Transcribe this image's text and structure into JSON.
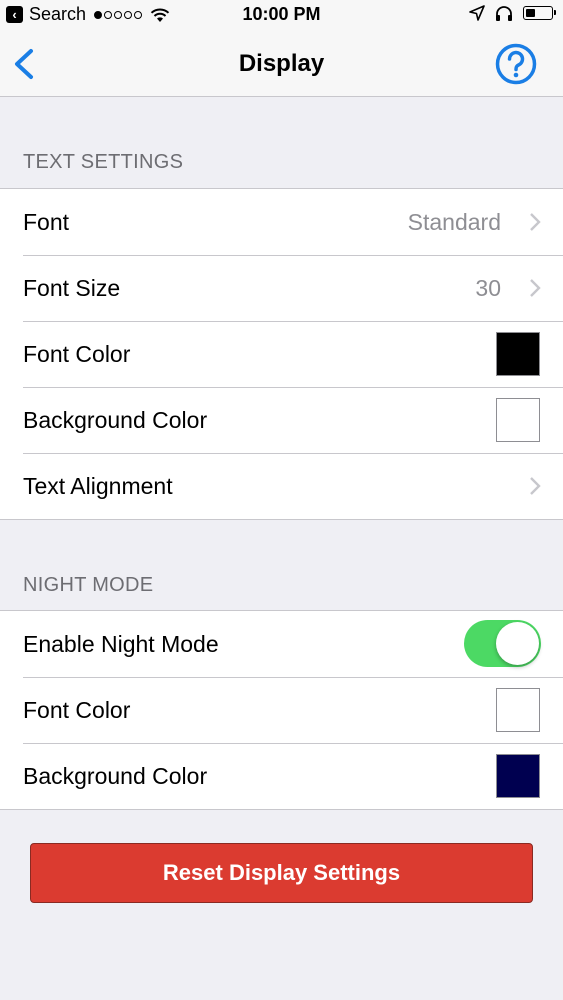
{
  "status_bar": {
    "back_app_label": "Search",
    "time": "10:00 PM",
    "signal_strength": 1
  },
  "nav": {
    "title": "Display",
    "back_icon": "chevron-left-icon",
    "help_icon": "question-circle-icon",
    "accent_color": "#1a7ee5"
  },
  "text_settings": {
    "header": "TEXT SETTINGS",
    "rows": [
      {
        "label": "Font",
        "value": "Standard"
      },
      {
        "label": "Font Size",
        "value": "30"
      },
      {
        "label": "Font Color",
        "swatch": "#000000"
      },
      {
        "label": "Background Color",
        "swatch": "#ffffff"
      },
      {
        "label": "Text Alignment"
      }
    ]
  },
  "night_mode": {
    "header": "NIGHT MODE",
    "rows": [
      {
        "label": "Enable Night Mode",
        "toggle_on": true,
        "toggle_color": "#4cd964"
      },
      {
        "label": "Font Color",
        "swatch": "#ffffff"
      },
      {
        "label": "Background Color",
        "swatch": "#000050"
      }
    ]
  },
  "reset": {
    "label": "Reset Display Settings",
    "color": "#db3b30"
  }
}
